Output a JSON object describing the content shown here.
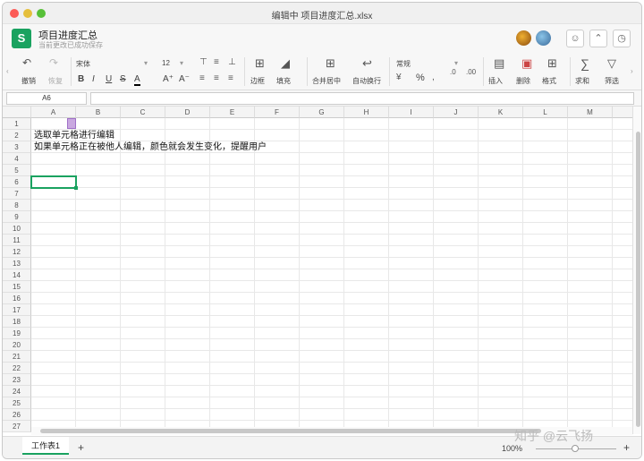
{
  "window": {
    "title": "编辑中 项目进度汇总.xlsx",
    "colors": {
      "close": "#fc5b57",
      "min": "#e5bf3c",
      "max": "#57c038"
    }
  },
  "doc": {
    "logo": "S",
    "name": "项目进度汇总",
    "status": "当前更改已成功保存",
    "buttons": [
      "add-user",
      "collapse",
      "history"
    ]
  },
  "toolbar": {
    "undo": "撤销",
    "redo": "恢复",
    "font": "宋体",
    "size": "12",
    "bold": "B",
    "italic": "I",
    "underline": "U",
    "strike": "S",
    "fontcolor": "A",
    "grow": "A⁺",
    "shrink": "A⁻",
    "border": "边框",
    "fill": "填充",
    "merge": "合并居中",
    "wrap": "自动换行",
    "numfmt": "常规",
    "percent": "%",
    "insert": "插入",
    "delete": "删除",
    "format": "格式",
    "sum": "求和",
    "filter": "筛选"
  },
  "formula": {
    "namebox": "A6",
    "value": ""
  },
  "grid": {
    "columns": [
      "A",
      "B",
      "C",
      "D",
      "E",
      "F",
      "G",
      "H",
      "I",
      "J",
      "K",
      "L",
      "M"
    ],
    "rows": [
      "1",
      "2",
      "3",
      "4",
      "5",
      "6",
      "7",
      "8",
      "9",
      "10",
      "11",
      "12",
      "13",
      "14",
      "15",
      "16",
      "17",
      "18",
      "19",
      "20",
      "21",
      "22",
      "23",
      "24",
      "25",
      "26",
      "27"
    ],
    "cells": {
      "A2": "选取单元格进行编辑",
      "A3": "如果单元格正在被他人编辑，颜色就会发生变化，提醒用户"
    },
    "selected": "A6"
  },
  "sheets": {
    "tabs": [
      "工作表1"
    ],
    "add": "+",
    "zoom": "100%",
    "zoom_in": "+"
  },
  "watermark": "知乎 @云飞扬"
}
